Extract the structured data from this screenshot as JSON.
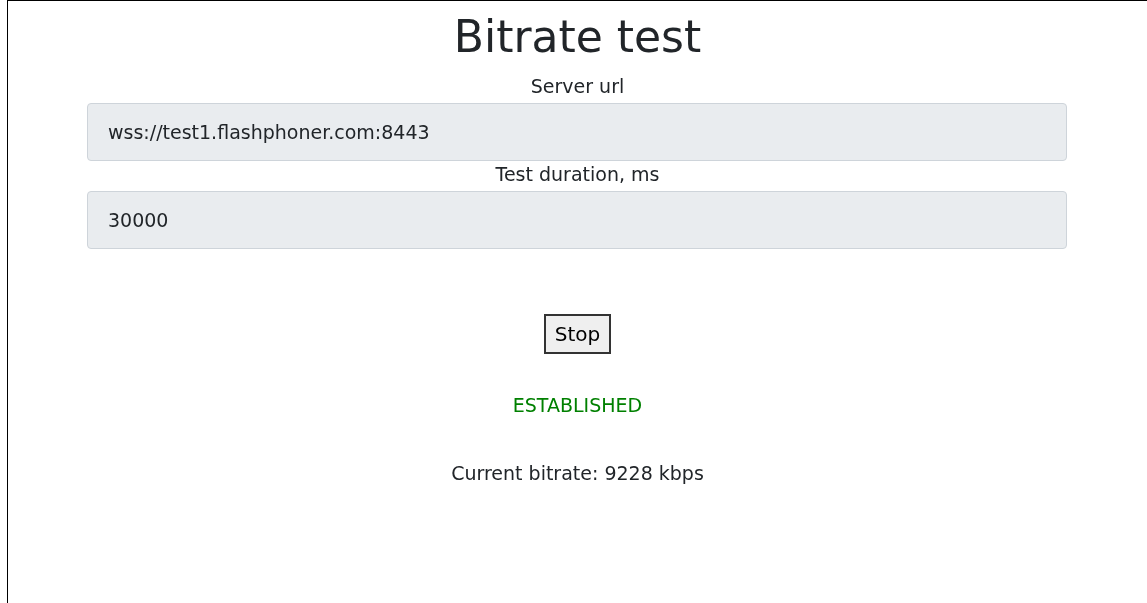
{
  "title": "Bitrate test",
  "fields": [
    {
      "label": "Server url",
      "value": "wss://test1.flashphoner.com:8443",
      "disabled": true
    },
    {
      "label": "Test duration, ms",
      "value": "30000",
      "disabled": true
    }
  ],
  "button": {
    "label": "Stop"
  },
  "status": "ESTABLISHED",
  "bitrate": "Current bitrate: 9228 kbps"
}
